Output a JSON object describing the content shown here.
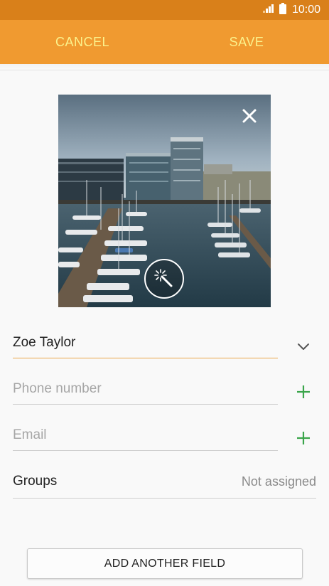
{
  "status_bar": {
    "time": "10:00",
    "signal_icon": "signal-icon",
    "battery_icon": "battery-icon"
  },
  "action_bar": {
    "cancel_label": "CANCEL",
    "save_label": "SAVE"
  },
  "colors": {
    "status_bar": "#d9801a",
    "action_bar": "#f09a30",
    "action_text": "#fbf28c",
    "plus": "#3aa54a",
    "name_underline": "#eba64a"
  },
  "photo": {
    "close_icon": "close-icon",
    "enhance_icon": "magic-wand-icon"
  },
  "form": {
    "name_value": "Zoe Taylor",
    "phone_placeholder": "Phone number",
    "email_placeholder": "Email",
    "groups_label": "Groups",
    "groups_value": "Not assigned",
    "add_field_label": "ADD ANOTHER FIELD"
  }
}
